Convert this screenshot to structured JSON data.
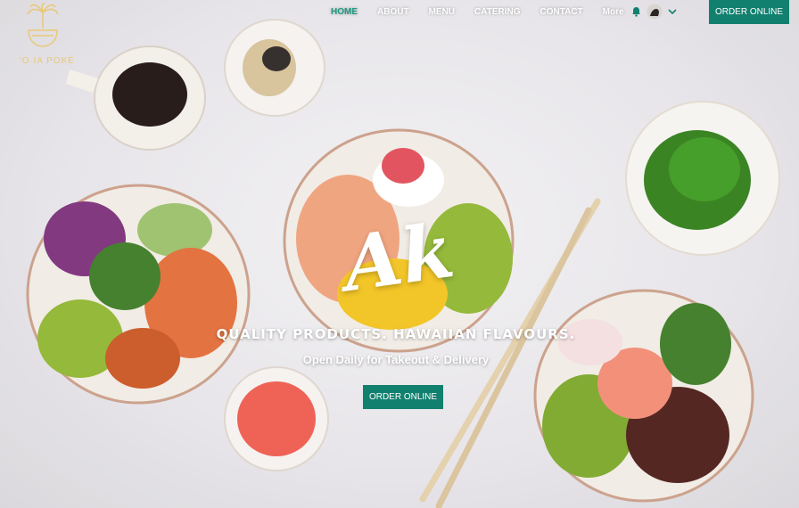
{
  "brand": {
    "name": "'O IA POKÉ"
  },
  "nav": {
    "items": [
      {
        "label": "HOME",
        "active": true
      },
      {
        "label": "ABOUT",
        "active": false
      },
      {
        "label": "MENU",
        "active": false
      },
      {
        "label": "CATERING",
        "active": false
      },
      {
        "label": "CONTACT",
        "active": false
      },
      {
        "label": "More",
        "active": false
      }
    ],
    "icons": [
      "bell-icon",
      "avatar",
      "chevron-down-icon"
    ]
  },
  "header": {
    "order_label": "ORDER ONLINE"
  },
  "hero": {
    "logo_text": "Ak",
    "tagline": "QUALITY PRODUCTS. HAWAIIAN FLAVOURS.",
    "subline": "Open Daily for Takeout & Delivery",
    "cta_label": "ORDER ONLINE"
  },
  "colors": {
    "accent": "#12806f",
    "active_nav": "#1e9a83",
    "brand_gold": "#e8c878"
  }
}
